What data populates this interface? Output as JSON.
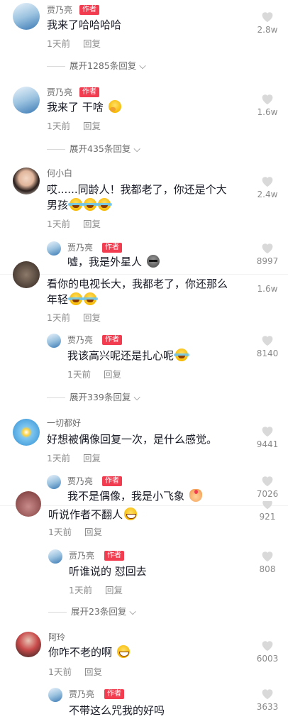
{
  "colors": {
    "author_badge": "#f23c50",
    "text": "#161823",
    "muted": "#8a8a8a"
  },
  "comments": [
    {
      "name": "贾乃亮",
      "badge": "作者",
      "text": "我来了哈哈哈哈",
      "time": "1天前",
      "reply": "回复",
      "likes": "2.8w",
      "expand": "展开1285条回复",
      "avatar": "jia-avatar"
    },
    {
      "name": "贾乃亮",
      "badge": "作者",
      "text": "我来了 干啥",
      "emoji": "thinking-emoji",
      "time": "1天前",
      "reply": "回复",
      "likes": "1.6w",
      "expand": "展开435条回复",
      "avatar": "jia-avatar"
    },
    {
      "name": "何小白",
      "text1": "哎......同龄人！我都老了，你还是个大",
      "text2": "男孩",
      "emoji": "laughing-crying-emoji",
      "time": "1天前",
      "reply": "回复",
      "likes": "2.4w",
      "avatar": "girl-avatar"
    },
    {
      "name": "贾乃亮",
      "badge": "作者",
      "text": "嘘，我是外星人",
      "emoji": "alien-emoji",
      "likes": "8997",
      "avatar": "jia-avatar"
    },
    {
      "text1": "看你的电视长大，我都老了，你还那么",
      "text2": "年轻",
      "emoji": "rofl-emoji",
      "time": "1天前",
      "reply": "回复",
      "likes": "1.6w"
    },
    {
      "name": "贾乃亮",
      "badge": "作者",
      "text": "我该高兴呢还是扎心呢",
      "emoji": "rofl-emoji",
      "time": "1天前",
      "reply": "回复",
      "likes": "8140",
      "expand": "展开339条回复",
      "avatar": "jia-avatar"
    },
    {
      "name": "一切都好",
      "text": "好想被偶像回复一次，是什么感觉。",
      "time": "1天前",
      "reply": "回复",
      "likes": "9441",
      "avatar": "flower-avatar"
    },
    {
      "name": "贾乃亮",
      "badge": "作者",
      "text": "我不是偶像，我是小飞象",
      "emoji": "hand-emoji",
      "likes": "7026",
      "avatar": "jia-avatar"
    },
    {
      "text": "听说作者不翻人",
      "emoji": "grin-emoji",
      "time": "1天前",
      "reply": "回复",
      "likes": "921"
    },
    {
      "name": "贾乃亮",
      "badge": "作者",
      "text": "听谁说的 怼回去",
      "time": "1天前",
      "reply": "回复",
      "likes": "808",
      "expand": "展开23条回复",
      "avatar": "jia-avatar"
    },
    {
      "name": "阿玲",
      "text": "你咋不老的啊",
      "emoji": "grin-emoji",
      "time": "1天前",
      "reply": "回复",
      "likes": "6003",
      "avatar": "aling-avatar"
    },
    {
      "name": "贾乃亮",
      "badge": "作者",
      "text": "不带这么咒我的好吗",
      "likes": "3633",
      "avatar": "jia-avatar"
    }
  ]
}
